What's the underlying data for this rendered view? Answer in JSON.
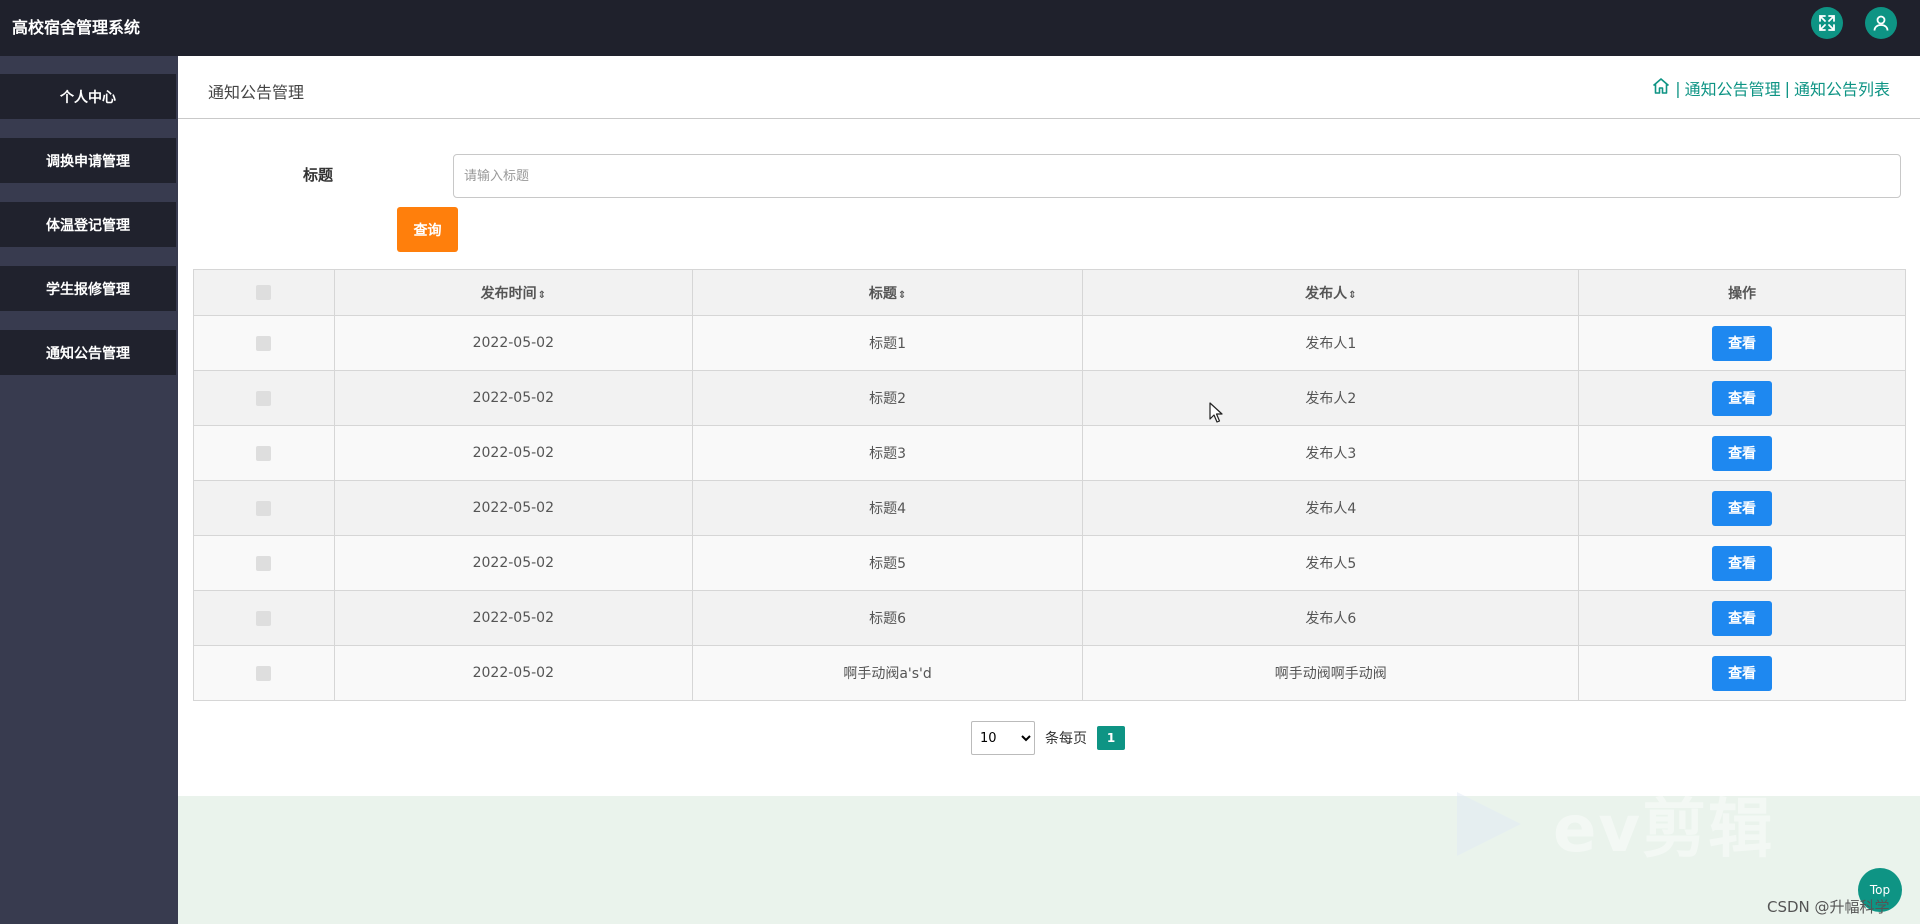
{
  "header": {
    "app_title": "高校宿舍管理系统",
    "fullscreen_icon": "fullscreen-icon",
    "user_icon": "user-icon"
  },
  "sidebar": {
    "items": [
      {
        "label": "个人中心"
      },
      {
        "label": "调换申请管理"
      },
      {
        "label": "体温登记管理"
      },
      {
        "label": "学生报修管理"
      },
      {
        "label": "通知公告管理"
      }
    ]
  },
  "page": {
    "title": "通知公告管理",
    "breadcrumb": {
      "home_icon": "home-icon",
      "separator": "|",
      "items": [
        "通知公告管理",
        "通知公告列表"
      ]
    }
  },
  "search": {
    "label": "标题",
    "placeholder": "请输入标题",
    "value": "",
    "button_label": "查询"
  },
  "table": {
    "columns": [
      "",
      "发布时间",
      "标题",
      "发布人",
      "操作"
    ],
    "sort_icon": "⇕",
    "action_label": "查看",
    "rows": [
      {
        "date": "2022-05-02",
        "title": "标题1",
        "publisher": "发布人1"
      },
      {
        "date": "2022-05-02",
        "title": "标题2",
        "publisher": "发布人2"
      },
      {
        "date": "2022-05-02",
        "title": "标题3",
        "publisher": "发布人3"
      },
      {
        "date": "2022-05-02",
        "title": "标题4",
        "publisher": "发布人4"
      },
      {
        "date": "2022-05-02",
        "title": "标题5",
        "publisher": "发布人5"
      },
      {
        "date": "2022-05-02",
        "title": "标题6",
        "publisher": "发布人6"
      },
      {
        "date": "2022-05-02",
        "title": "啊手动阀a's'd",
        "publisher": "啊手动阀啊手动阀"
      }
    ]
  },
  "pagination": {
    "page_size": "10",
    "page_size_options": [
      "10"
    ],
    "per_page_label": "条每页",
    "current_page": "1"
  },
  "overlay": {
    "watermark_text": "ev剪辑",
    "top_button_label": "Top",
    "csdn_label": "CSDN @升幅科学"
  },
  "colors": {
    "accent": "#0e9484",
    "query_button": "#ff7f0c",
    "view_button": "#1e88f0",
    "topbar": "#1f212c",
    "sidebar_item": "#20222d"
  }
}
